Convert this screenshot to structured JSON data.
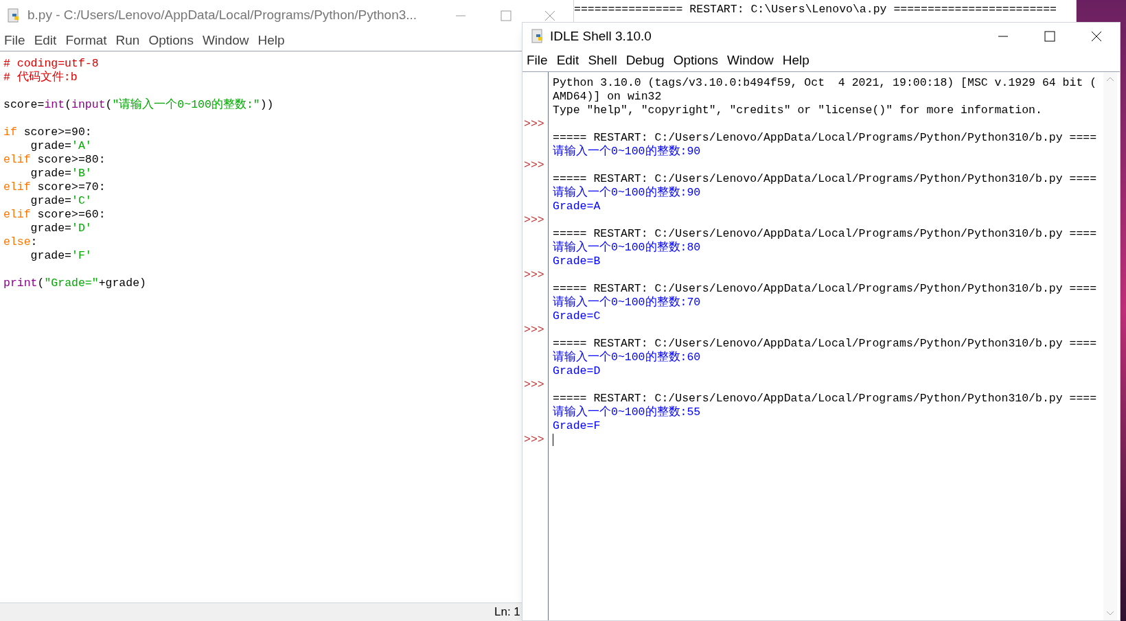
{
  "background_window": {
    "line": "================ RESTART: C:\\Users\\Lenovo\\a.py ========================"
  },
  "editor": {
    "title": "b.py - C:/Users/Lenovo/AppData/Local/Programs/Python/Python3...",
    "menu": [
      "File",
      "Edit",
      "Format",
      "Run",
      "Options",
      "Window",
      "Help"
    ],
    "code_blocks": [
      [
        [
          {
            "kind": "comment",
            "text": "# coding=utf-8"
          }
        ],
        [
          {
            "kind": "comment",
            "text": "# 代码文件:b"
          }
        ]
      ],
      [
        [
          {
            "kind": "plain",
            "text": "score="
          },
          {
            "kind": "builtin",
            "text": "int"
          },
          {
            "kind": "plain",
            "text": "("
          },
          {
            "kind": "builtin",
            "text": "input"
          },
          {
            "kind": "plain",
            "text": "("
          },
          {
            "kind": "string",
            "text": "\"请输入一个0~100的整数:\""
          },
          {
            "kind": "plain",
            "text": "))"
          }
        ]
      ],
      [
        [
          {
            "kind": "keyword",
            "text": "if"
          },
          {
            "kind": "plain",
            "text": " score>=90:"
          }
        ],
        [
          {
            "kind": "plain",
            "text": "    grade="
          },
          {
            "kind": "string",
            "text": "'A'"
          }
        ],
        [
          {
            "kind": "keyword",
            "text": "elif"
          },
          {
            "kind": "plain",
            "text": " score>=80:"
          }
        ],
        [
          {
            "kind": "plain",
            "text": "    grade="
          },
          {
            "kind": "string",
            "text": "'B'"
          }
        ],
        [
          {
            "kind": "keyword",
            "text": "elif"
          },
          {
            "kind": "plain",
            "text": " score>=70:"
          }
        ],
        [
          {
            "kind": "plain",
            "text": "    grade="
          },
          {
            "kind": "string",
            "text": "'C'"
          }
        ],
        [
          {
            "kind": "keyword",
            "text": "elif"
          },
          {
            "kind": "plain",
            "text": " score>=60:"
          }
        ],
        [
          {
            "kind": "plain",
            "text": "    grade="
          },
          {
            "kind": "string",
            "text": "'D'"
          }
        ],
        [
          {
            "kind": "keyword",
            "text": "else"
          },
          {
            "kind": "plain",
            "text": ":"
          }
        ],
        [
          {
            "kind": "plain",
            "text": "    grade="
          },
          {
            "kind": "string",
            "text": "'F'"
          }
        ]
      ],
      [
        [
          {
            "kind": "builtin",
            "text": "print"
          },
          {
            "kind": "plain",
            "text": "("
          },
          {
            "kind": "string",
            "text": "\"Grade=\""
          },
          {
            "kind": "plain",
            "text": "+grade)"
          }
        ]
      ]
    ],
    "status": "Ln: 1"
  },
  "shell": {
    "title": "IDLE Shell 3.10.0",
    "menu": [
      "File",
      "Edit",
      "Shell",
      "Debug",
      "Options",
      "Window",
      "Help"
    ],
    "lines": [
      {
        "kind": "output",
        "text": "Python 3.10.0 (tags/v3.10.0:b494f59, Oct  4 2021, 19:00:18) [MSC v.1929 64 bit ("
      },
      {
        "kind": "output",
        "text": "AMD64)] on win32"
      },
      {
        "kind": "output",
        "text": "Type \"help\", \"copyright\", \"credits\" or \"license()\" for more information."
      },
      {
        "kind": "prompt",
        "prompt": ">>>"
      },
      {
        "kind": "output",
        "text": "===== RESTART: C:/Users/Lenovo/AppData/Local/Programs/Python/Python310/b.py ===="
      },
      {
        "kind": "stdout",
        "text": "请输入一个0~100的整数:90"
      },
      {
        "kind": "prompt",
        "prompt": ">>>"
      },
      {
        "kind": "output",
        "text": "===== RESTART: C:/Users/Lenovo/AppData/Local/Programs/Python/Python310/b.py ===="
      },
      {
        "kind": "stdout",
        "text": "请输入一个0~100的整数:90"
      },
      {
        "kind": "stdout",
        "text": "Grade=A"
      },
      {
        "kind": "prompt",
        "prompt": ">>>"
      },
      {
        "kind": "output",
        "text": "===== RESTART: C:/Users/Lenovo/AppData/Local/Programs/Python/Python310/b.py ===="
      },
      {
        "kind": "stdout",
        "text": "请输入一个0~100的整数:80"
      },
      {
        "kind": "stdout",
        "text": "Grade=B"
      },
      {
        "kind": "prompt",
        "prompt": ">>>"
      },
      {
        "kind": "output",
        "text": "===== RESTART: C:/Users/Lenovo/AppData/Local/Programs/Python/Python310/b.py ===="
      },
      {
        "kind": "stdout",
        "text": "请输入一个0~100的整数:70"
      },
      {
        "kind": "stdout",
        "text": "Grade=C"
      },
      {
        "kind": "prompt",
        "prompt": ">>>"
      },
      {
        "kind": "output",
        "text": "===== RESTART: C:/Users/Lenovo/AppData/Local/Programs/Python/Python310/b.py ===="
      },
      {
        "kind": "stdout",
        "text": "请输入一个0~100的整数:60"
      },
      {
        "kind": "stdout",
        "text": "Grade=D"
      },
      {
        "kind": "prompt",
        "prompt": ">>>"
      },
      {
        "kind": "output",
        "text": "===== RESTART: C:/Users/Lenovo/AppData/Local/Programs/Python/Python310/b.py ===="
      },
      {
        "kind": "stdout",
        "text": "请输入一个0~100的整数:55"
      },
      {
        "kind": "stdout",
        "text": "Grade=F"
      },
      {
        "kind": "prompt",
        "prompt": ">>>",
        "cursor": true
      }
    ]
  }
}
